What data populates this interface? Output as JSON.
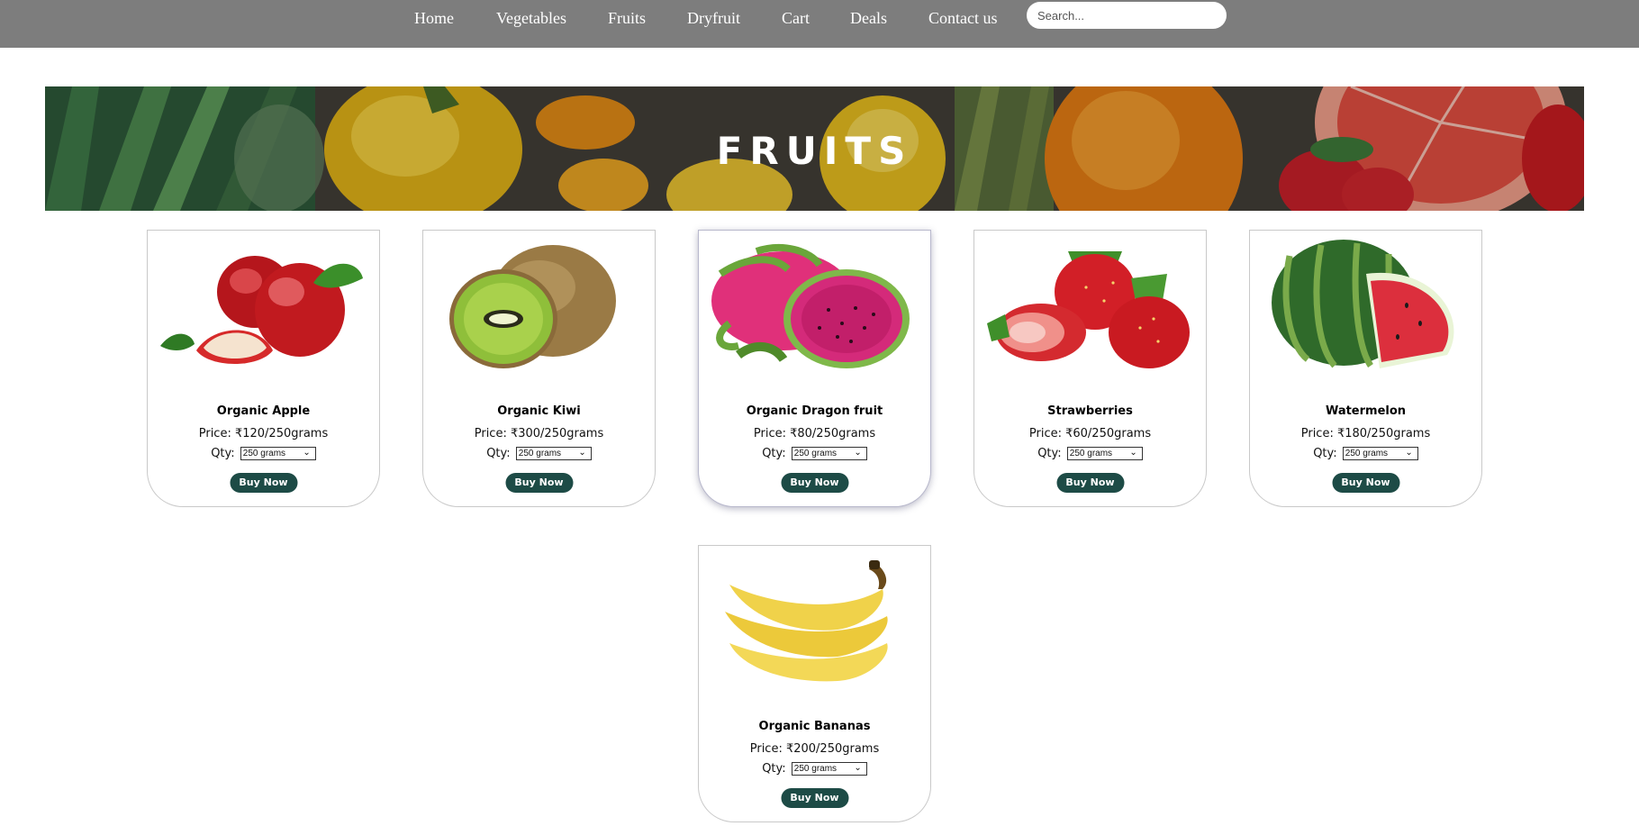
{
  "nav": {
    "links": [
      "Home",
      "Vegetables",
      "Fruits",
      "Dryfruit",
      "Cart",
      "Deals",
      "Contact us"
    ],
    "search_placeholder": "Search..."
  },
  "banner": {
    "title": "FRUITS"
  },
  "colors": {
    "nav_bg": "#7d7d7d",
    "button_bg": "#1d4b46",
    "button_text": "#ffffff"
  },
  "products": [
    {
      "name": "Organic Apple",
      "price": "Price: ₹120/250grams",
      "qty_label": "Qty:",
      "qty_value": "250 grams",
      "button": "Buy Now",
      "image": "apple"
    },
    {
      "name": "Organic Kiwi",
      "price": "Price: ₹300/250grams",
      "qty_label": "Qty:",
      "qty_value": "250 grams",
      "button": "Buy Now",
      "image": "kiwi"
    },
    {
      "name": "Organic Dragon fruit",
      "price": "Price: ₹80/250grams",
      "qty_label": "Qty:",
      "qty_value": "250 grams",
      "button": "Buy Now",
      "image": "dragon-fruit"
    },
    {
      "name": "Strawberries",
      "price": "Price: ₹60/250grams",
      "qty_label": "Qty:",
      "qty_value": "250 grams",
      "button": "Buy Now",
      "image": "strawberries"
    },
    {
      "name": "Watermelon",
      "price": "Price: ₹180/250grams",
      "qty_label": "Qty:",
      "qty_value": "250 grams",
      "button": "Buy Now",
      "image": "watermelon"
    },
    {
      "name": "Organic Bananas",
      "price": "Price: ₹200/250grams",
      "qty_label": "Qty:",
      "qty_value": "250 grams",
      "button": "Buy Now",
      "image": "bananas"
    }
  ]
}
